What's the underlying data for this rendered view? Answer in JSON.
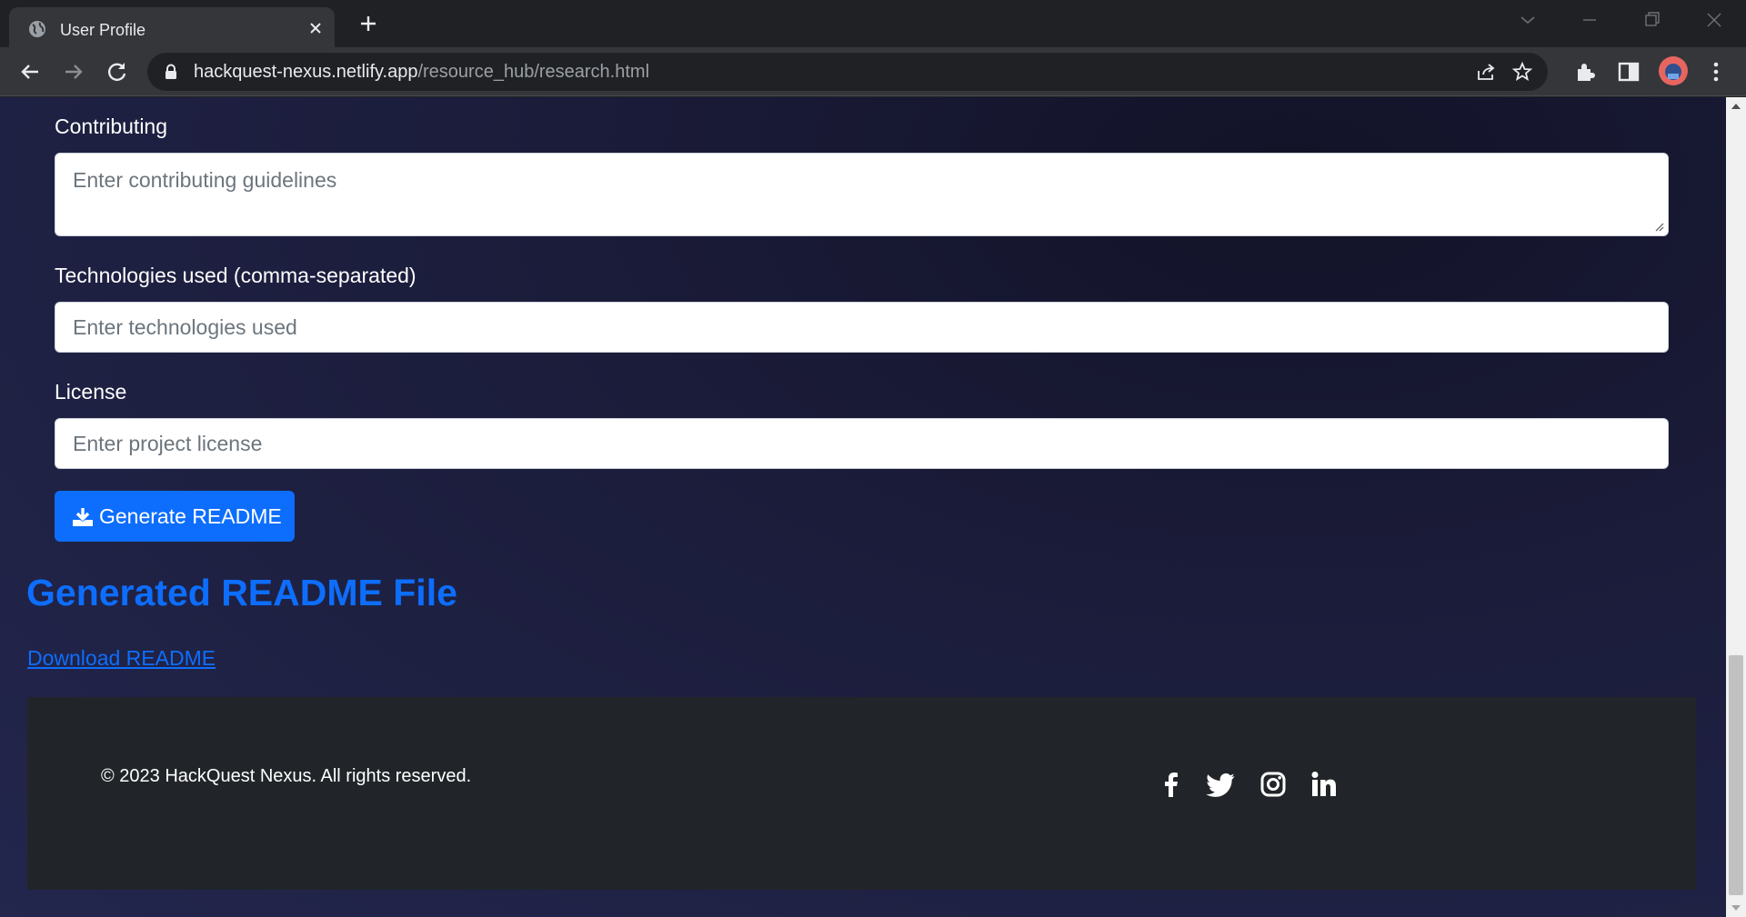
{
  "browser": {
    "tab_title": "User Profile",
    "url_host": "hackquest-nexus.netlify.app",
    "url_path": "/resource_hub/research.html"
  },
  "form": {
    "contributing_label": "Contributing",
    "contributing_placeholder": "Enter contributing guidelines",
    "technologies_label": "Technologies used (comma-separated)",
    "technologies_placeholder": "Enter technologies used",
    "license_label": "License",
    "license_placeholder": "Enter project license",
    "generate_button_label": "Generate README",
    "generate_button_icon": "download-icon"
  },
  "result": {
    "heading": "Generated README File",
    "download_link": "Download README"
  },
  "footer": {
    "copyright": "© 2023 HackQuest Nexus. All rights reserved.",
    "social_icons": [
      "facebook-icon",
      "twitter-icon",
      "instagram-icon",
      "linkedin-icon"
    ]
  },
  "colors": {
    "accent": "#0d6efd",
    "footer_bg": "#212529",
    "page_bg": "#1b1c3a"
  }
}
